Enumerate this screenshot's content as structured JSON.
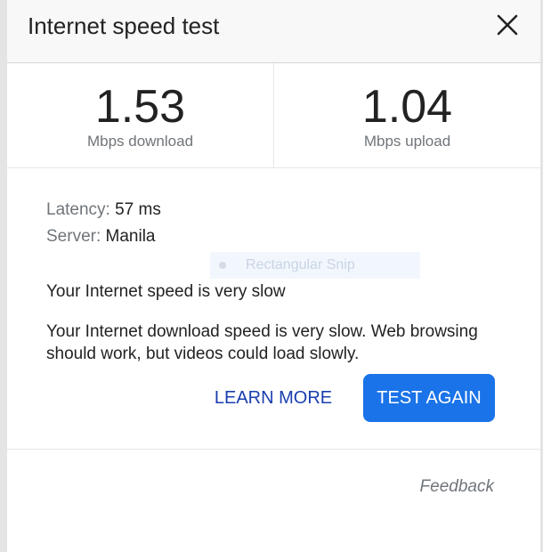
{
  "header": {
    "title": "Internet speed test",
    "close_icon": "close-icon"
  },
  "speeds": {
    "download": {
      "value": "1.53",
      "unit": "Mbps download"
    },
    "upload": {
      "value": "1.04",
      "unit": "Mbps upload"
    }
  },
  "details": {
    "latency_label": "Latency:",
    "latency_value": "57 ms",
    "server_label": "Server:",
    "server_value": "Manila"
  },
  "status": "Your Internet speed is very slow",
  "description": "Your Internet download speed is very slow. Web browsing should work, but videos could load slowly.",
  "overlay": {
    "label": "Rectangular Snip"
  },
  "actions": {
    "learn_more": "LEARN MORE",
    "test_again": "TEST AGAIN"
  },
  "footer": {
    "feedback": "Feedback"
  },
  "colors": {
    "accent": "#1a73e8",
    "link": "#1a3eb0",
    "secondary_text": "#70757a"
  }
}
